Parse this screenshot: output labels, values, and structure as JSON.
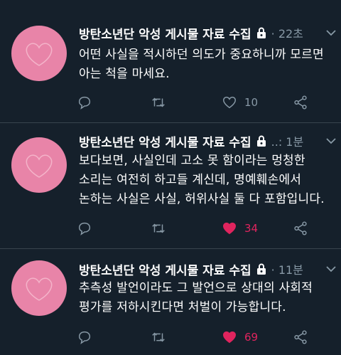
{
  "tweets": [
    {
      "name": "방탄소년단 악성 게시물 자료 수집",
      "meta": "· 22초",
      "text_lines": [
        "어떤 사실을 적시하던 의도가 중요하니까 모르면",
        "아는 척을 마세요."
      ],
      "like_count": "10",
      "liked": false
    },
    {
      "name": "방탄소년단 악성 게시물 자료 수집",
      "meta": "..: 1분",
      "text_lines": [
        "보다보면, 사실인데 고소 못 함이라는 멍청한",
        "소리는 여전히 하고들 계신데, 명예훼손에서",
        "논하는 사실은 사실, 허위사실 둘 다 포함입니다."
      ],
      "like_count": "34",
      "liked": true
    },
    {
      "name": "방탄소년단 악성 게시물 자료 수집",
      "meta": "· 11분",
      "text_lines": [
        "추측성 발언이라도 그 발언으로 상대의 사회적",
        "평가를 저하시킨다면 처벌이 가능합니다."
      ],
      "like_count": "69",
      "liked": true
    }
  ],
  "colors": {
    "background": "#15202b",
    "avatar": "#e884a8",
    "secondary_text": "#8899a6",
    "like_active": "#e0245e",
    "divider": "#38444d"
  },
  "icons": [
    "reply-icon",
    "retweet-icon",
    "like-icon",
    "share-icon",
    "lock-icon",
    "chevron-down-icon",
    "heart-avatar-icon"
  ]
}
